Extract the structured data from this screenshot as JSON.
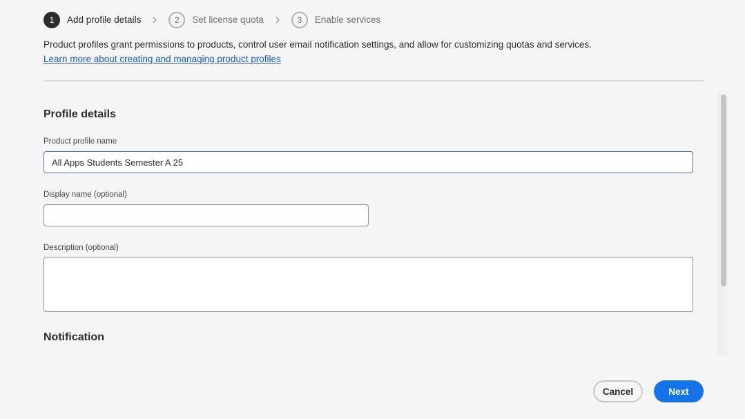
{
  "stepper": {
    "steps": [
      {
        "number": "1",
        "label": "Add profile details",
        "state": "active"
      },
      {
        "number": "2",
        "label": "Set license quota",
        "state": "inactive"
      },
      {
        "number": "3",
        "label": "Enable services",
        "state": "inactive"
      }
    ]
  },
  "intro": {
    "text": "Product profiles grant permissions to products, control user email notification settings, and allow for customizing quotas and services.",
    "link_text": "Learn more about creating and managing product profiles"
  },
  "profile_details": {
    "title": "Profile details",
    "name_label": "Product profile name",
    "name_value": "All Apps Students Semester A 25",
    "display_label": "Display name (optional)",
    "display_value": "",
    "description_label": "Description (optional)",
    "description_value": ""
  },
  "notification": {
    "title": "Notification"
  },
  "footer": {
    "cancel_label": "Cancel",
    "next_label": "Next"
  },
  "colors": {
    "accent": "#1473e6",
    "link": "#1a5ab8",
    "background": "#f5f5f5",
    "focus_border": "#4b75c4"
  },
  "icons": {
    "step_separator": "chevron-right-icon"
  }
}
